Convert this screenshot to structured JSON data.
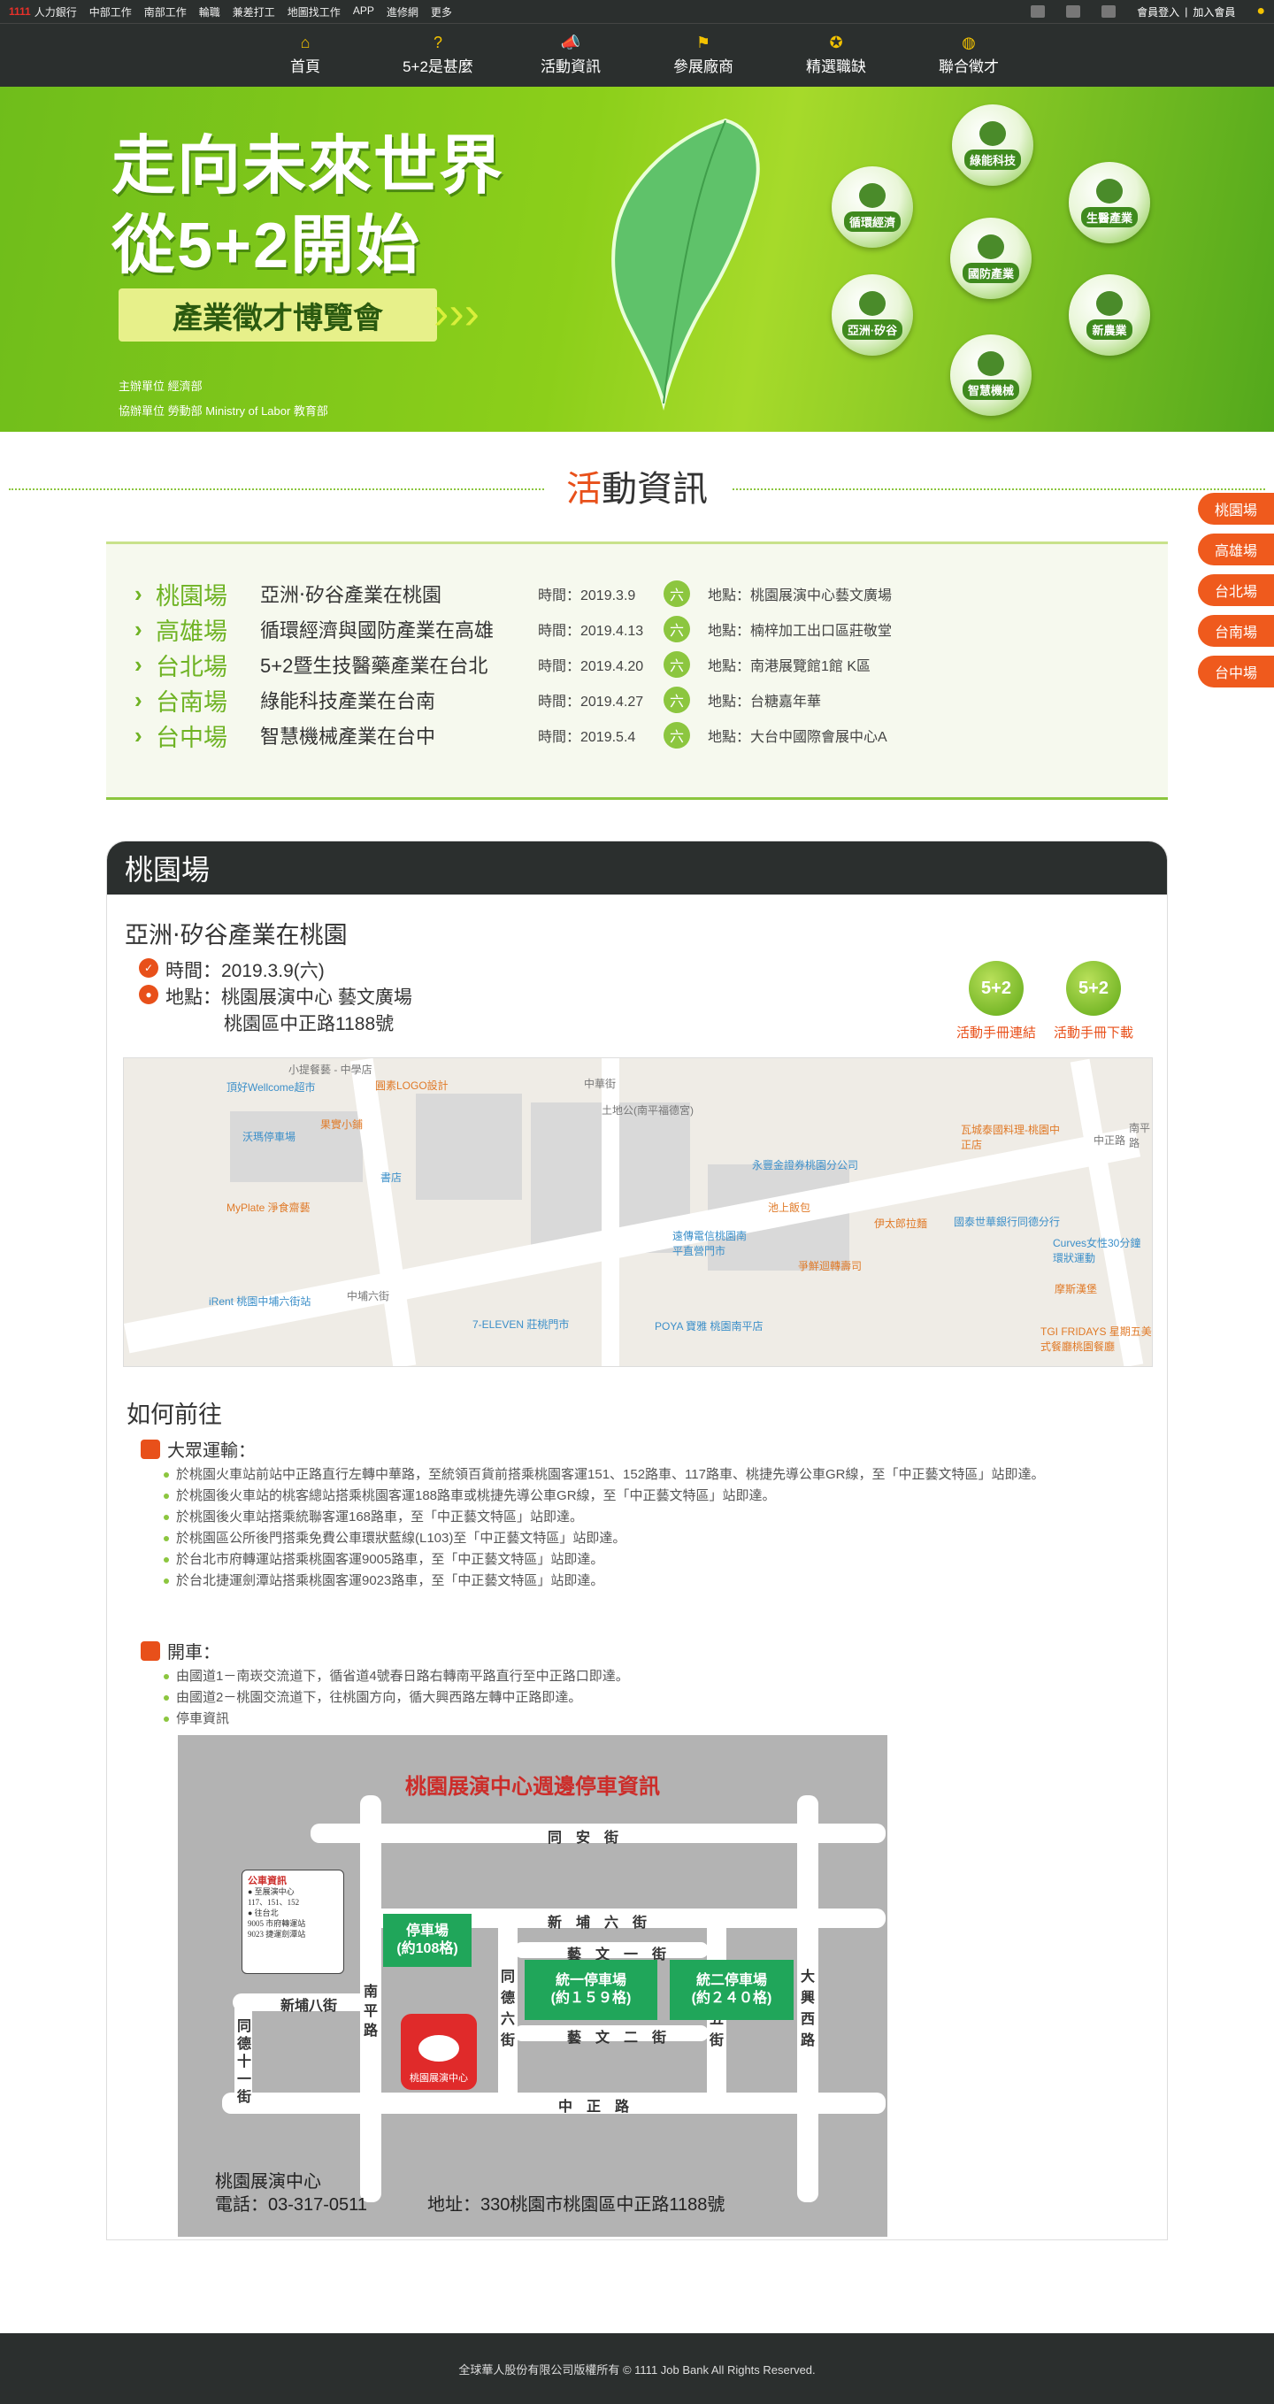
{
  "topbar": {
    "logo": "1111",
    "links": [
      "人力銀行",
      "中部工作",
      "南部工作",
      "輪職",
      "兼差打工",
      "地圖找工作",
      "APP",
      "進修網",
      "更多"
    ],
    "member_login": "會員登入",
    "join_member": "加入會員",
    "divider": "|"
  },
  "nav": {
    "items": [
      {
        "icon": "home-icon",
        "glyph": "⌂",
        "label": "首頁"
      },
      {
        "icon": "question-icon",
        "glyph": "?",
        "label": "5+2是甚麼"
      },
      {
        "icon": "megaphone-icon",
        "glyph": "📣",
        "label": "活動資訊"
      },
      {
        "icon": "flag-icon",
        "glyph": "⚑",
        "label": "參展廠商"
      },
      {
        "icon": "badge-icon",
        "glyph": "✪",
        "label": "精選職缺"
      },
      {
        "icon": "globe-icon",
        "glyph": "◍",
        "label": "聯合徵才"
      }
    ]
  },
  "banner": {
    "line1": "走向未來世界",
    "line2": "從5+2開始",
    "subtitle": "產業徵才博覽會",
    "arrows": "›››",
    "organizer": "主辦單位 經濟部",
    "co_organizer": "協辦單位 勞動部 Ministry of Labor 教育部",
    "bubbles": [
      "綠能科技",
      "循環經濟",
      "生醫產業",
      "國防產業",
      "亞洲·矽谷",
      "新農業",
      "智慧機械"
    ]
  },
  "section": {
    "title_highlight": "活",
    "title_rest": "動資訊"
  },
  "sidetabs": [
    "桃園場",
    "高雄場",
    "台北場",
    "台南場",
    "台中場"
  ],
  "schedule": [
    {
      "city": "桃園場",
      "theme": "亞洲‧矽谷產業在桃園",
      "time": "時間：2019.3.9",
      "day": "六",
      "location": "地點：桃園展演中心藝文廣場"
    },
    {
      "city": "高雄場",
      "theme": "循環經濟與國防產業在高雄",
      "time": "時間：2019.4.13",
      "day": "六",
      "location": "地點：楠梓加工出口區莊敬堂"
    },
    {
      "city": "台北場",
      "theme": "5+2暨生技醫藥產業在台北",
      "time": "時間：2019.4.20",
      "day": "六",
      "location": "地點：南港展覽館1館 K區"
    },
    {
      "city": "台南場",
      "theme": "綠能科技產業在台南",
      "time": "時間：2019.4.27",
      "day": "六",
      "location": "地點：台糖嘉年華"
    },
    {
      "city": "台中場",
      "theme": "智慧機械產業在台中",
      "time": "時間：2019.5.4",
      "day": "六",
      "location": "地點：大台中國際會展中心A"
    }
  ],
  "venue": {
    "header": "桃園場",
    "name": "亞洲‧矽谷產業在桃園",
    "time": "時間：2019.3.9(六)",
    "place_line1": "地點：桃園展演中心 藝文廣場",
    "place_line2": "桃園區中正路1188號",
    "btn_link_icon": "5+2",
    "btn_link": "活動手冊連結",
    "btn_download_icon": "5+2",
    "btn_download": "活動手冊下載"
  },
  "map": {
    "labels_gray": [
      "小提餐藝 - 中學店",
      "中華街",
      "土地公(南平福德宮)",
      "中正路",
      "南平路",
      "中埔六街"
    ],
    "labels_orange": [
      "圓素LOGO設計",
      "果實小鋪",
      "MyPlate 淨食齋藝",
      "池上飯包",
      "伊太郎拉麵",
      "爭鮮迴轉壽司",
      "瓦城泰國料理-桃園中正店",
      "摩斯漢堡",
      "TGI FRIDAYS 星期五美式餐廳桃園餐廳"
    ],
    "labels_blue": [
      "頂好Wellcome超市",
      "沃瑪停車場",
      "書店",
      "永豐金證券桃園分公司",
      "遠傳電信桃園南平直營門市",
      "國泰世華銀行同德分行",
      "Curves女性30分鐘環狀運動",
      "iRent 桃園中埔六街站",
      "7-ELEVEN 莊桃門市",
      "POYA 寶雅 桃園南平店"
    ]
  },
  "howto": {
    "title": "如何前往",
    "transit_title": "大眾運輸：",
    "transit": [
      "於桃園火車站前站中正路直行左轉中華路，至統領百貨前搭乘桃園客運151、152路車、117路車、桃捷先導公車GR線，至「中正藝文特區」站即達。",
      "於桃園後火車站的桃客總站搭乘桃園客運188路車或桃捷先導公車GR線，至「中正藝文特區」站即達。",
      "於桃園後火車站搭乘統聯客運168路車，至「中正藝文特區」站即達。",
      "於桃園區公所後門搭乘免費公車環狀藍線(L103)至「中正藝文特區」站即達。",
      "於台北市府轉運站搭乘桃園客運9005路車，至「中正藝文特區」站即達。",
      "於台北捷運劍潭站搭乘桃園客運9023路車，至「中正藝文特區」站即達。"
    ],
    "drive_title": "開車：",
    "drive": [
      "由國道1－南崁交流道下，循省道4號春日路右轉南平路直行至中正路口即達。",
      "由國道2－桃園交流道下，往桃園方向，循大興西路左轉中正路即達。",
      "停車資訊"
    ]
  },
  "parking": {
    "title": "桃園展演中心週邊停車資訊",
    "roads": {
      "tongan": "同　安　街",
      "xinpu6": "新　埔　六　街",
      "yiwen1": "藝　文　一　街",
      "yiwen2": "藝　文　二　街",
      "zhongzheng": "中　正　路",
      "xinpu8": "新埔八街",
      "nanping": [
        "南",
        "平",
        "路"
      ],
      "tongde11": [
        "同",
        "德",
        "十",
        "一",
        "街"
      ],
      "tongde6": [
        "同",
        "德",
        "六",
        "街"
      ],
      "tongde5": [
        "同",
        "德",
        "五",
        "街"
      ],
      "daxingxi": [
        "大",
        "興",
        "西",
        "路"
      ]
    },
    "lot1": [
      "停車場",
      "(約108格)"
    ],
    "lot2": [
      "統一停車場",
      "(約１５９格)"
    ],
    "lot3": [
      "統二停車場",
      "(約２４０格)"
    ],
    "note_title": "公車資訊",
    "note_lines": [
      "● 至展演中心",
      "117、151、152",
      "● 往台北",
      "9005 市府轉運站",
      "9023 捷運劍潭站"
    ],
    "logo_label": "桃園展演中心",
    "footer_name": "桃園展演中心",
    "footer_phone": "電話：03-317-0511",
    "footer_address": "地址：330桃園市桃園區中正路1188號"
  },
  "footer": {
    "copyright": "全球華人股份有限公司版權所有 © 1111 Job Bank All Rights Reserved."
  },
  "colors": {
    "accent_green": "#8cc63f",
    "accent_orange": "#ef5a1d",
    "dark": "#2b2f2e",
    "lot_green": "#20a65a",
    "title_red": "#cc2d2a"
  }
}
